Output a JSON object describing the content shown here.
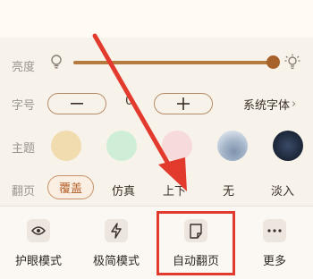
{
  "brightness": {
    "label": "亮度",
    "level_fraction": 1.0
  },
  "font_size": {
    "label": "字号",
    "decrease_symbol": "−",
    "value": "0",
    "increase_symbol": "+",
    "font_link": "系统字体",
    "font_link_arrow": "›"
  },
  "theme": {
    "label": "主题",
    "swatches": [
      {
        "name": "beige",
        "color": "#f1dcb0"
      },
      {
        "name": "green",
        "color": "#cfeed8"
      },
      {
        "name": "pink",
        "color": "#f7dada"
      },
      {
        "name": "landscape",
        "color": "#b7c6d8"
      },
      {
        "name": "night",
        "color": "#1f2a3d"
      }
    ]
  },
  "page_flip": {
    "label": "翻页",
    "options": [
      "覆盖",
      "仿真",
      "上下",
      "无",
      "淡入"
    ],
    "selected": "覆盖",
    "accent": "#b3602b"
  },
  "toolbar": {
    "items": [
      {
        "icon": "eye-icon",
        "label": "护眼模式"
      },
      {
        "icon": "lightning-icon",
        "label": "极简模式"
      },
      {
        "icon": "document-icon",
        "label": "自动翻页"
      },
      {
        "icon": "more-dots-icon",
        "label": "更多"
      }
    ]
  },
  "annotation": {
    "color": "#e23a2c"
  }
}
